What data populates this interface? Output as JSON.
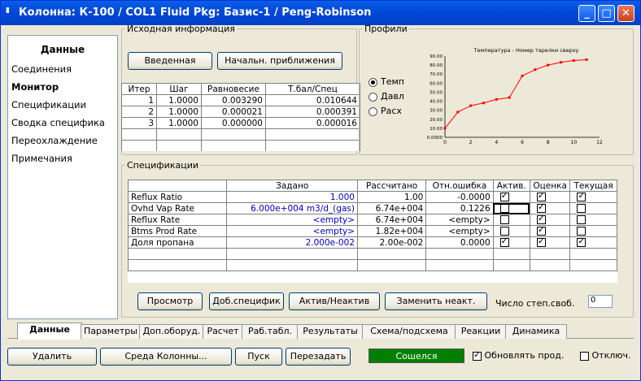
{
  "window": {
    "title": "Колонна: К-100 / COL1  Fluid Pkg: Базис-1 / Peng-Robinson",
    "icon": "column-icon",
    "controls": [
      "minimize-icon",
      "maximize-icon",
      "close-icon"
    ],
    "colors": {
      "titlebar": "#0048d8",
      "face": "#ece9d8",
      "status_ok": "#008000",
      "chart_line": "#ff0000"
    }
  },
  "nav": {
    "header": "Данные",
    "items": [
      {
        "label": "Соединения",
        "selected": false
      },
      {
        "label": "Монитор",
        "selected": true
      },
      {
        "label": "Спецификации",
        "selected": false
      },
      {
        "label": "Сводка специфика",
        "selected": false
      },
      {
        "label": "Переохлаждение",
        "selected": false
      },
      {
        "label": "Примечания",
        "selected": false
      }
    ]
  },
  "input_group": {
    "legend": "Исходная информация",
    "btn_input": "Введенная",
    "btn_initial": "Начальн. приближения"
  },
  "iterations": {
    "columns": [
      "Итер",
      "Шаг",
      "Равновесие",
      "Т.бал/Спец"
    ],
    "rows": [
      [
        "1",
        "1.0000",
        "0.003290",
        "0.010644"
      ],
      [
        "2",
        "1.0000",
        "0.000021",
        "0.000391"
      ],
      [
        "3",
        "1.0000",
        "0.000000",
        "0.000016"
      ]
    ]
  },
  "profiles": {
    "legend": "Профили",
    "options": [
      {
        "label": "Темп",
        "selected": true
      },
      {
        "label": "Давл",
        "selected": false
      },
      {
        "label": "Расх",
        "selected": false
      }
    ]
  },
  "chart_data": {
    "type": "line",
    "title": "Температура - Номер тарелки сверху",
    "xlabel": "",
    "ylabel": "",
    "xlim": [
      0,
      12
    ],
    "ylim": [
      0,
      90
    ],
    "xticks": [
      "0",
      "2",
      "4",
      "6",
      "8",
      "10",
      "12"
    ],
    "yticks": [
      "0.0000",
      "10.00",
      "20.00",
      "30.00",
      "40.00",
      "50.00",
      "60.00",
      "70.00",
      "80.00",
      "90.00"
    ],
    "x": [
      0,
      1,
      2,
      3,
      4,
      5,
      6,
      7,
      8,
      9,
      10,
      11
    ],
    "y": [
      10,
      28,
      35,
      38,
      42,
      44,
      68,
      75,
      80,
      83,
      85,
      86
    ],
    "grid": false
  },
  "specs": {
    "legend": "Спецификации",
    "columns": [
      "",
      "Задано",
      "Рассчитано",
      "Отн.ошибка",
      "Актив.",
      "Оценка",
      "Текущая"
    ],
    "rows": [
      {
        "name": "Reflux Ratio",
        "spec": "1.000",
        "calc": "1.00",
        "err": "-0.0000",
        "active": true,
        "estimate": true,
        "current": true
      },
      {
        "name": "Ovhd Vap Rate",
        "spec": "6.000e+004 m3/d_(gas)",
        "calc": "6.74e+004",
        "err": "0.1226",
        "active": false,
        "estimate": true,
        "current": false
      },
      {
        "name": "Reflux Rate",
        "spec": "<empty>",
        "calc": "6.74e+004",
        "err": "<empty>",
        "active": false,
        "estimate": true,
        "current": false
      },
      {
        "name": "Btms Prod Rate",
        "spec": "<empty>",
        "calc": "1.82e+004",
        "err": "<empty>",
        "active": false,
        "estimate": true,
        "current": false
      },
      {
        "name": "Доля пропана",
        "spec": "2.000e-002",
        "calc": "2.00e-002",
        "err": "0.0000",
        "active": true,
        "estimate": true,
        "current": true
      }
    ],
    "btn_view": "Просмотр",
    "btn_add": "Доб.специфик",
    "btn_toggle": "Актив/Неактив",
    "btn_replace": "Заменить неакт.",
    "dof_label": "Число степ.своб.",
    "dof_value": "0"
  },
  "tabs": [
    "Данные",
    "Параметры",
    "Доп.оборуд.",
    "Расчет",
    "Раб.табл.",
    "Результаты",
    "Схема/подсхема",
    "Реакции",
    "Динамика"
  ],
  "bottom": {
    "btn_delete": "Удалить",
    "btn_env": "Среда Колонны...",
    "btn_run": "Пуск",
    "btn_reset": "Перезадать",
    "status": "Сошелся",
    "chk_update": "Обновлять прод.",
    "chk_update_on": true,
    "chk_disable": "Отключ.",
    "chk_disable_on": false
  }
}
